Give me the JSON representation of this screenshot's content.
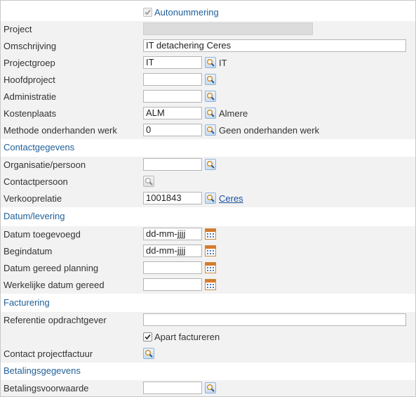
{
  "autonummering": {
    "label": "Autonummering",
    "checked": true
  },
  "rows": {
    "project": {
      "label": "Project",
      "value": ""
    },
    "omschrijving": {
      "label": "Omschrijving",
      "value": "IT detachering Ceres"
    },
    "projectgroep": {
      "label": "Projectgroep",
      "value": "IT",
      "desc": "IT"
    },
    "hoofdproject": {
      "label": "Hoofdproject",
      "value": ""
    },
    "administratie": {
      "label": "Administratie",
      "value": ""
    },
    "kostenplaats": {
      "label": "Kostenplaats",
      "value": "ALM",
      "desc": "Almere"
    },
    "methode": {
      "label": "Methode onderhanden werk",
      "value": "0",
      "desc": "Geen onderhanden werk"
    },
    "organisatie": {
      "label": "Organisatie/persoon",
      "value": ""
    },
    "contactpersoon": {
      "label": "Contactpersoon"
    },
    "verkooprelatie": {
      "label": "Verkooprelatie",
      "value": "1001843",
      "desc": "Ceres"
    },
    "datum_toegevoegd": {
      "label": "Datum toegevoegd",
      "value": "dd-mm-jjjj"
    },
    "begindatum": {
      "label": "Begindatum",
      "value": "dd-mm-jjjj"
    },
    "datum_gereed_planning": {
      "label": "Datum gereed planning",
      "value": ""
    },
    "werkelijke_datum": {
      "label": "Werkelijke datum gereed",
      "value": ""
    },
    "referentie": {
      "label": "Referentie opdrachtgever",
      "value": ""
    },
    "apart_factureren": {
      "label": "Apart factureren",
      "checked": true
    },
    "contact_projectfactuur": {
      "label": "Contact projectfactuur"
    },
    "betalingsvoorwaarde": {
      "label": "Betalingsvoorwaarde",
      "value": ""
    }
  },
  "sections": {
    "contactgegevens": "Contactgegevens",
    "datum_levering": "Datum/levering",
    "facturering": "Facturering",
    "betalingsgegevens": "Betalingsgegevens"
  },
  "colors": {
    "section": "#1f5f99",
    "row_bg": "#f2f2f2",
    "link": "#1a4fa0"
  }
}
